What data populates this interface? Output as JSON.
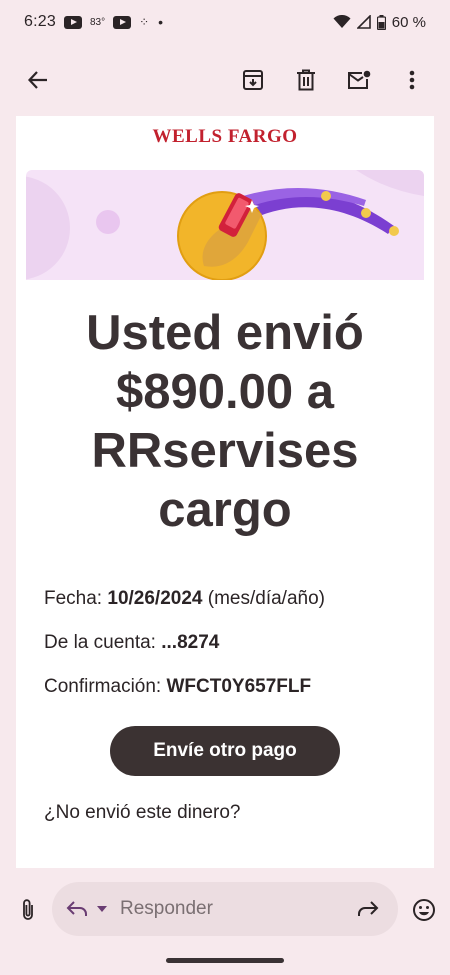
{
  "status_bar": {
    "time": "6:23",
    "temperature": "83°",
    "battery_percent": "60 %"
  },
  "app_bar": {
    "back_icon": "arrow-left-icon",
    "actions": [
      "archive-icon",
      "trash-icon",
      "mark-unread-icon",
      "more-vert-icon"
    ]
  },
  "email": {
    "brand": "WELLS FARGO",
    "headline": "Usted envió $890.00 a RRservises cargo",
    "details": {
      "date_label": "Fecha:",
      "date_value": "10/26/2024",
      "date_format": "(mes/día/año)",
      "account_label": "De la cuenta:",
      "account_value": "...8274",
      "confirmation_label": "Confirmación:",
      "confirmation_value": "WFCT0Y657FLF"
    },
    "cta_label": "Envíe otro pago",
    "question": "¿No envió este dinero?"
  },
  "reply_bar": {
    "placeholder": "Responder"
  },
  "colors": {
    "background": "#f7e9ed",
    "brand_red": "#c2212e",
    "cta_dark": "#3b3232",
    "hero_purple": "#7b3fd1",
    "hero_gold": "#f2b52a"
  }
}
